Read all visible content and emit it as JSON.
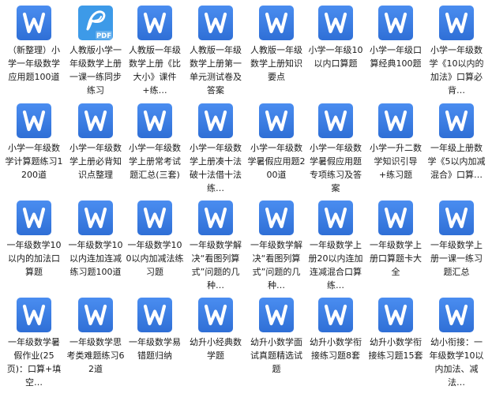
{
  "colors": {
    "word_icon_top": "#4a8df0",
    "word_icon_bottom": "#2f6fd6",
    "pdf_icon": "#3d9ae8",
    "label_text": "#1a1a1a",
    "background": "#ffffff"
  },
  "files": [
    {
      "name": "（新整理）小学一年级数学应用题100道",
      "icon": "word-document-icon"
    },
    {
      "name": "人教版小学一年级数学上册一课一练同步练习",
      "icon": "pdf-document-icon",
      "badge": "PDF"
    },
    {
      "name": "人教版一年级数学上册《比大小》课件+练…",
      "icon": "word-document-icon"
    },
    {
      "name": "人教版一年级数学上册第一单元测试卷及答案",
      "icon": "word-document-icon"
    },
    {
      "name": "人教版一年级数学上册知识要点",
      "icon": "word-document-icon"
    },
    {
      "name": "小学一年级10以内口算题",
      "icon": "word-document-icon"
    },
    {
      "name": "小学一年级口算经典100题",
      "icon": "word-document-icon"
    },
    {
      "name": "小学一年级数学《10以内的加法》口算必背…",
      "icon": "word-document-icon"
    },
    {
      "name": "小学一年级数学计算题练习1200道",
      "icon": "word-document-icon"
    },
    {
      "name": "小学一年级数学上册必背知识点整理",
      "icon": "word-document-icon"
    },
    {
      "name": "小学一年级数学上册常考试题汇总(三套)",
      "icon": "word-document-icon"
    },
    {
      "name": "小学一年级数学上册凑十法破十法借十法练…",
      "icon": "word-document-icon"
    },
    {
      "name": "小学一年级数学暑假应用题200道",
      "icon": "word-document-icon"
    },
    {
      "name": "小学一年级数学暑假应用题专项练习及答案",
      "icon": "word-document-icon"
    },
    {
      "name": "小学一升二数学知识引导+练习题",
      "icon": "word-document-icon"
    },
    {
      "name": "一年级上册数学《5以内加减混合》口算…",
      "icon": "word-document-icon"
    },
    {
      "name": "一年级数学10以内的加法口算题",
      "icon": "word-document-icon"
    },
    {
      "name": "一年级数学10以内连加连减练习题100道",
      "icon": "word-document-icon"
    },
    {
      "name": "一年级数学100以内加减法练习题",
      "icon": "word-document-icon"
    },
    {
      "name": "一年级数学解决“看图列算式”问题的几种…",
      "icon": "word-document-icon"
    },
    {
      "name": "一年级数学解决“看图列算式”问题的几种…",
      "icon": "word-document-icon"
    },
    {
      "name": "一年级数学上册20以内连加连减混合口算练…",
      "icon": "word-document-icon"
    },
    {
      "name": "一年级数学上册口算题卡大全",
      "icon": "word-document-icon"
    },
    {
      "name": "一年级数学上册一课一练习题汇总",
      "icon": "word-document-icon"
    },
    {
      "name": "一年级数学暑假作业(25页)：口算+填空…",
      "icon": "word-document-icon"
    },
    {
      "name": "一年级数学思考类难题练习62道",
      "icon": "word-document-icon"
    },
    {
      "name": "一年级数学易错题归纳",
      "icon": "word-document-icon"
    },
    {
      "name": "幼升小经典数学题",
      "icon": "word-document-icon"
    },
    {
      "name": "幼升小数学面试真题精选试题",
      "icon": "word-document-icon"
    },
    {
      "name": "幼升小数学衔接练习题8套",
      "icon": "word-document-icon"
    },
    {
      "name": "幼升小数学衔接练习题15套",
      "icon": "word-document-icon"
    },
    {
      "name": "幼小衔接：一年级数学10以内加法、减法…",
      "icon": "word-document-icon"
    }
  ]
}
